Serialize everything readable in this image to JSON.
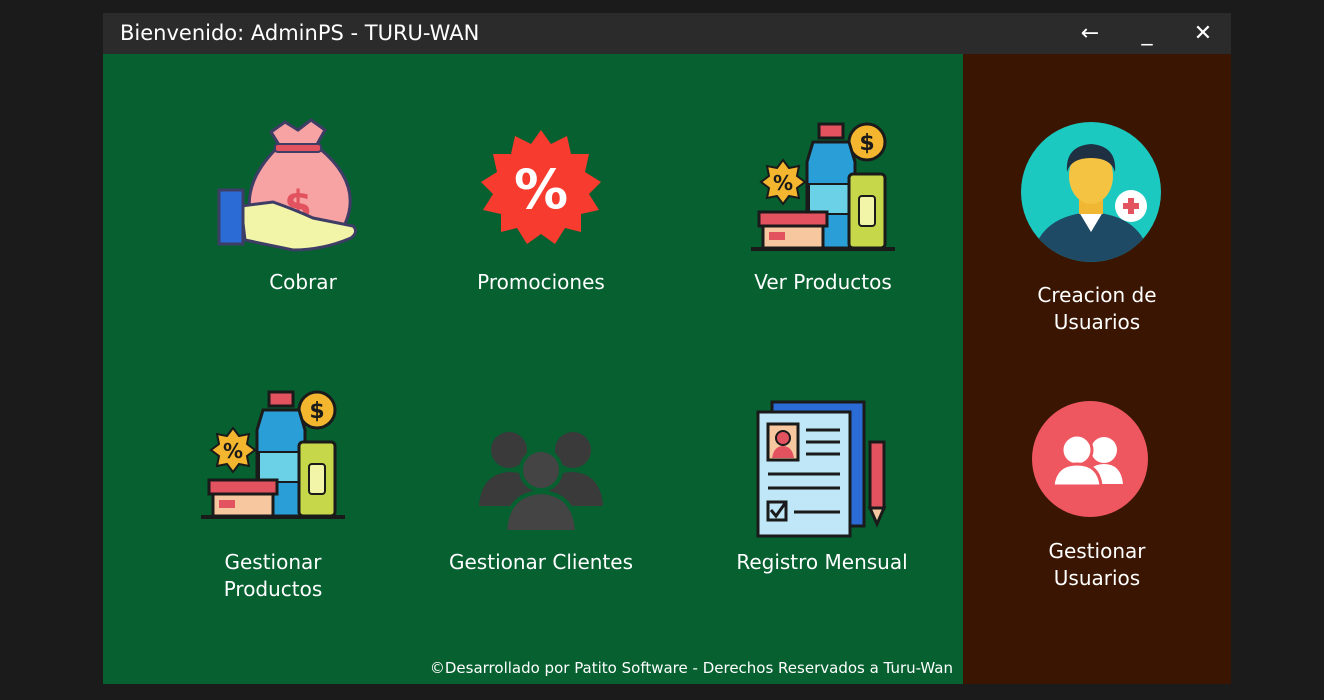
{
  "window": {
    "title": "Bienvenido: AdminPS - TURU-WAN",
    "back_label": "←",
    "minimize_label": "_",
    "close_label": "✕"
  },
  "main": {
    "tiles": [
      {
        "label": "Cobrar",
        "icon": "money-bag-hand-icon"
      },
      {
        "label": "Promociones",
        "icon": "percent-badge-icon"
      },
      {
        "label": "Ver Productos",
        "icon": "products-icon"
      },
      {
        "label": "Gestionar\nProductos",
        "icon": "products-icon"
      },
      {
        "label": "Gestionar Clientes",
        "icon": "group-users-icon"
      },
      {
        "label": "Registro Mensual",
        "icon": "document-register-icon"
      }
    ],
    "footer": "©Desarrollado por Patito Software - Derechos Reservados a Turu-Wan"
  },
  "side": {
    "items": [
      {
        "label": "Creacion de\nUsuarios",
        "icon": "user-add-icon"
      },
      {
        "label": "Gestionar\nUsuarios",
        "icon": "users-icon"
      }
    ]
  },
  "colors": {
    "main_bg": "#066030",
    "side_bg": "#3a1602",
    "titlebar_bg": "#2b2b2b"
  }
}
